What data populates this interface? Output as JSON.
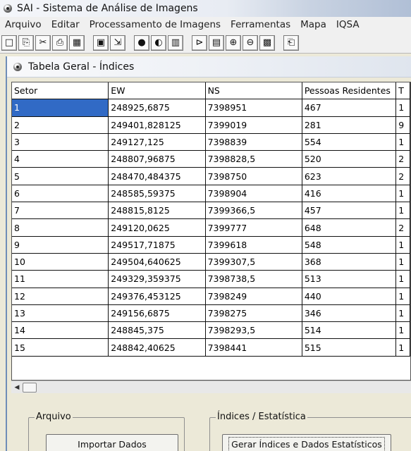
{
  "window": {
    "title": "SAI - Sistema de Análise de Imagens"
  },
  "menu": [
    "Arquivo",
    "Editar",
    "Processamento de Imagens",
    "Ferramentas",
    "Mapa",
    "IQSA"
  ],
  "toolbar_icons": [
    "new-icon",
    "open-icon",
    "cut-icon",
    "print-icon",
    "grid-icon",
    "save-icon",
    "export-icon",
    "fill-icon",
    "layer-icon",
    "chart-icon",
    "filter-icon",
    "image-icon",
    "zoom-in-icon",
    "zoom-out-icon",
    "texture-icon",
    "paste-icon"
  ],
  "child_window": {
    "title": "Tabela Geral - Índices"
  },
  "table": {
    "columns": [
      "Setor",
      "EW",
      "NS",
      "Pessoas Residentes",
      "T"
    ],
    "rows": [
      [
        "1",
        "248925,6875",
        "7398951",
        "467",
        "1"
      ],
      [
        "2",
        "249401,828125",
        "7399019",
        "281",
        "9"
      ],
      [
        "3",
        "249127,125",
        "7398839",
        "554",
        "1"
      ],
      [
        "4",
        "248807,96875",
        "7398828,5",
        "520",
        "2"
      ],
      [
        "5",
        "248470,484375",
        "7398750",
        "623",
        "2"
      ],
      [
        "6",
        "248585,59375",
        "7398904",
        "416",
        "1"
      ],
      [
        "7",
        "248815,8125",
        "7399366,5",
        "457",
        "1"
      ],
      [
        "8",
        "249120,0625",
        "7399777",
        "648",
        "2"
      ],
      [
        "9",
        "249517,71875",
        "7399618",
        "548",
        "1"
      ],
      [
        "10",
        "249504,640625",
        "7399307,5",
        "368",
        "1"
      ],
      [
        "11",
        "249329,359375",
        "7398738,5",
        "513",
        "1"
      ],
      [
        "12",
        "249376,453125",
        "7398249",
        "440",
        "1"
      ],
      [
        "13",
        "249156,6875",
        "7398275",
        "346",
        "1"
      ],
      [
        "14",
        "248845,375",
        "7398293,5",
        "514",
        "1"
      ],
      [
        "15",
        "248842,40625",
        "7398441",
        "515",
        "1"
      ]
    ],
    "selected_row": 0
  },
  "groups": {
    "arquivo": {
      "legend": "Arquivo",
      "button": "Importar Dados"
    },
    "indices": {
      "legend": "Índices / Estatística",
      "button": "Gerar Índices e Dados Estatísticos"
    }
  }
}
